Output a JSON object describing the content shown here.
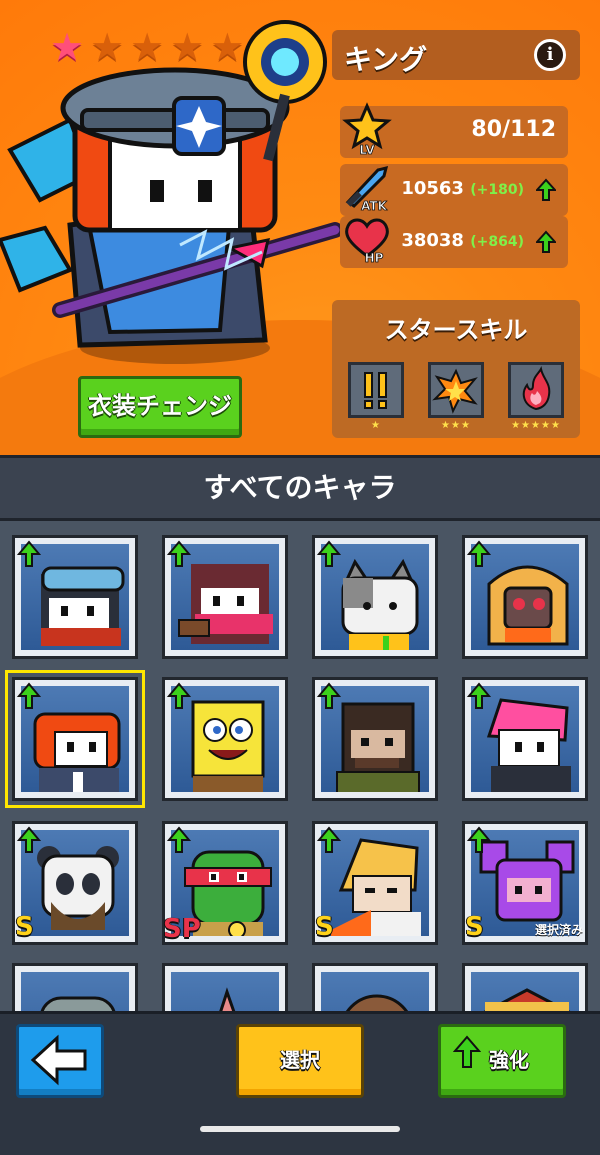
{
  "hero": {
    "rarity_stars_total": 5,
    "rarity_stars_filled": 1,
    "character_name": "キング",
    "info_icon_text": "i",
    "stats": {
      "level_label": "LV",
      "level_value": "80/112",
      "atk_label": "ATK",
      "atk_value": "10563",
      "atk_bonus": "(+180)",
      "hp_label": "HP",
      "hp_value": "38038",
      "hp_bonus": "(+864)"
    },
    "star_skill": {
      "title": "スタースキル",
      "skills": [
        {
          "icon": "exclamation-skill-icon",
          "stars": "★"
        },
        {
          "icon": "explosion-skill-icon",
          "stars": "★★★"
        },
        {
          "icon": "flame-skill-icon",
          "stars": "★★★★★"
        }
      ]
    },
    "costume_button": "衣装チェンジ"
  },
  "roster": {
    "title": "すべてのキャラ",
    "rows": [
      [
        {
          "name": "goggles-ninja",
          "upgradable": true,
          "tag": "",
          "tag_text": ""
        },
        {
          "name": "masked-girl",
          "upgradable": true,
          "tag": "",
          "tag_text": ""
        },
        {
          "name": "cat",
          "upgradable": true,
          "tag": "",
          "tag_text": ""
        },
        {
          "name": "hooded-robot",
          "upgradable": true,
          "tag": "",
          "tag_text": ""
        }
      ],
      [
        {
          "name": "king-selected",
          "upgradable": true,
          "tag": "",
          "tag_text": ""
        },
        {
          "name": "sponge",
          "upgradable": true,
          "tag": "",
          "tag_text": ""
        },
        {
          "name": "soldier",
          "upgradable": true,
          "tag": "",
          "tag_text": ""
        },
        {
          "name": "pink-hair",
          "upgradable": true,
          "tag": "",
          "tag_text": ""
        }
      ],
      [
        {
          "name": "panda",
          "upgradable": true,
          "tag": "S",
          "tag_text": ""
        },
        {
          "name": "turtle",
          "upgradable": true,
          "tag": "SP",
          "tag_text": ""
        },
        {
          "name": "blonde-fighter",
          "upgradable": true,
          "tag": "S",
          "tag_text": ""
        },
        {
          "name": "purple-mech",
          "upgradable": true,
          "tag": "S",
          "tag_text": "選択済み"
        }
      ]
    ]
  },
  "bottom": {
    "back_icon": "left-arrow-icon",
    "select_label": "選択",
    "upgrade_label": "強化"
  },
  "colors": {
    "accent_orange": "#ff8a12",
    "button_green": "#5ad11e",
    "button_yellow": "#ffc21a",
    "button_blue": "#1e9cec",
    "upgrade_arrow": "#3cd11c",
    "bonus_text": "#7ff04a",
    "selected_outline": "#ffe600"
  }
}
